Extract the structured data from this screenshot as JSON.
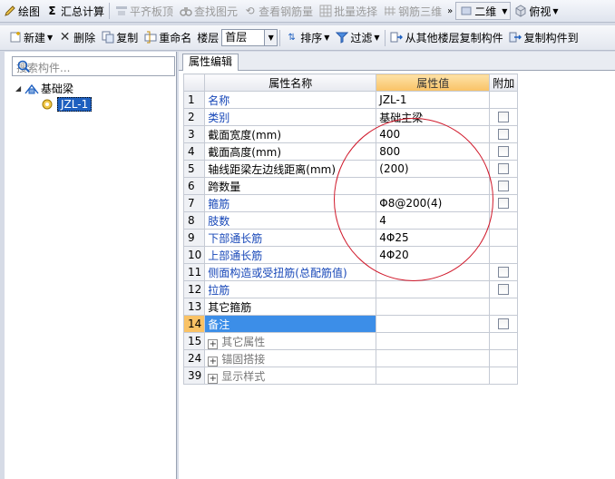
{
  "toolbar_top": {
    "draw": "绘图",
    "calc": "汇总计算",
    "align_top": "平齐板顶",
    "find": "查找图元",
    "view_rebar": "查看钢筋量",
    "batch_select": "批量选择",
    "rebar_3d": "钢筋三维",
    "view_2d": "二维",
    "view_top": "俯视"
  },
  "toolbar_second": {
    "new": "新建",
    "delete": "删除",
    "copy": "复制",
    "rename": "重命名",
    "floor_label": "楼层",
    "floor_value": "首层",
    "sort": "排序",
    "filter": "过滤",
    "copy_from_floor": "从其他楼层复制构件",
    "copy_to": "复制构件到"
  },
  "left_panel": {
    "search_placeholder": "搜索构件...",
    "tree_root": "基础梁",
    "tree_child": "JZL-1"
  },
  "right_panel": {
    "tab": "属性编辑",
    "columns": {
      "name": "属性名称",
      "value": "属性值",
      "extra": "附加"
    },
    "rows": [
      {
        "num": "1",
        "name": "名称",
        "value": "JZL-1"
      },
      {
        "num": "2",
        "name": "类别",
        "value": "基础主梁"
      },
      {
        "num": "3",
        "name": "截面宽度(mm)",
        "value": "400"
      },
      {
        "num": "4",
        "name": "截面高度(mm)",
        "value": "800"
      },
      {
        "num": "5",
        "name": "轴线距梁左边线距离(mm)",
        "value": "(200)"
      },
      {
        "num": "6",
        "name": "跨数量",
        "value": ""
      },
      {
        "num": "7",
        "name": "箍筋",
        "value": "Φ8@200(4)"
      },
      {
        "num": "8",
        "name": "肢数",
        "value": "4"
      },
      {
        "num": "9",
        "name": "下部通长筋",
        "value": "4Φ25"
      },
      {
        "num": "10",
        "name": "上部通长筋",
        "value": "4Φ20"
      },
      {
        "num": "11",
        "name": "侧面构造或受扭筋(总配筋值)",
        "value": ""
      },
      {
        "num": "12",
        "name": "拉筋",
        "value": ""
      },
      {
        "num": "13",
        "name": "其它箍筋",
        "value": ""
      },
      {
        "num": "14",
        "name": "备注",
        "value": ""
      },
      {
        "num": "15",
        "name": "其它属性",
        "value": ""
      },
      {
        "num": "24",
        "name": "锚固搭接",
        "value": ""
      },
      {
        "num": "39",
        "name": "显示样式",
        "value": ""
      }
    ]
  }
}
